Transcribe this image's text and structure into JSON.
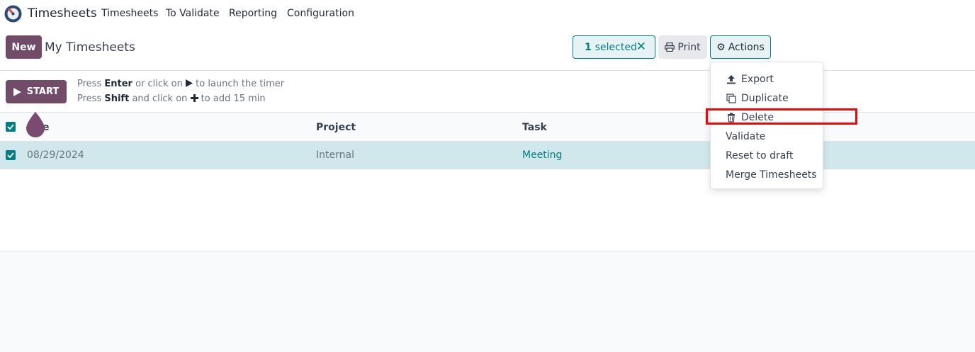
{
  "topnav": {
    "app_name": "Timesheets",
    "menu": [
      "Timesheets",
      "To Validate",
      "Reporting",
      "Configuration"
    ]
  },
  "controlbar": {
    "new_label": "New",
    "title": "My Timesheets",
    "selected_count": "1",
    "selected_text": "selected",
    "print_label": "Print",
    "actions_label": "Actions"
  },
  "timer": {
    "start_label": "START",
    "hint1": {
      "pre": "Press ",
      "key": "Enter",
      "post": " or click on ",
      "icon": "play-icon",
      "end": " to launch the timer"
    },
    "hint2": {
      "pre": "Press ",
      "key": "Shift",
      "post": " and click on ",
      "icon": "plus-icon",
      "end": " to add 15 min"
    }
  },
  "table": {
    "columns": [
      "Date",
      "Project",
      "Task"
    ],
    "visible_first_header_fragment": "e",
    "rows": [
      {
        "date": "08/29/2024",
        "project": "Internal",
        "task": "Meeting",
        "checked": true
      }
    ]
  },
  "actions_menu": {
    "items": [
      {
        "label": "Export",
        "icon": "upload-icon"
      },
      {
        "label": "Duplicate",
        "icon": "copy-icon"
      },
      {
        "label": "Delete",
        "icon": "trash-icon"
      },
      {
        "label": "Validate",
        "icon": ""
      },
      {
        "label": "Reset to draft",
        "icon": ""
      },
      {
        "label": "Merge Timesheets",
        "icon": ""
      }
    ]
  },
  "colors": {
    "brand": "#714b67",
    "accent": "#017e84",
    "selected_row": "#d0e8ec",
    "highlight": "#ff0000"
  }
}
